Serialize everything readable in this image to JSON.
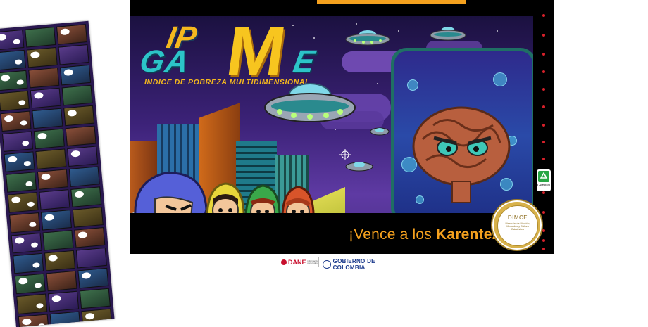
{
  "game": {
    "logo": {
      "ip": "IP",
      "ga": "GA",
      "m": "M",
      "e": "E",
      "subtitle": "INDICE DE POBREZA MULTIDIMENSIONAL"
    },
    "tagline_prefix": "¡Vence a los ",
    "tagline_emphasis": "Karentez",
    "tagline_suffix": "!"
  },
  "seal": {
    "title": "DIMCE",
    "text": "Dirección de Difusión, Mercadeo y Cultura Estadística"
  },
  "side_widget": {
    "label": "General",
    "icon": "recycle-icon"
  },
  "footer": {
    "dane_label": "DANE",
    "dane_sub": "información para todos",
    "gov_label": "GOBIERNO DE COLOMBIA"
  },
  "colors": {
    "accent_orange": "#f5a11e",
    "logo_teal": "#2cc4c8",
    "logo_yellow": "#f7c51f",
    "sky_purple": "#3c2278"
  }
}
